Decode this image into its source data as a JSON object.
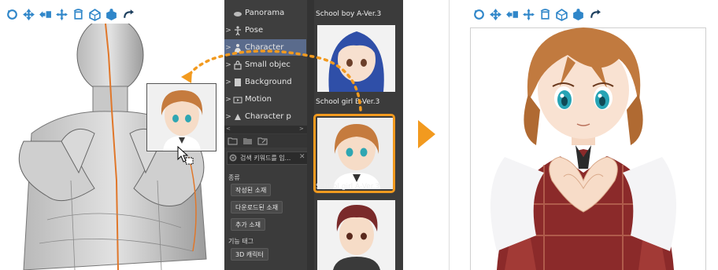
{
  "toolbar": {
    "icons": [
      "rotate-camera-icon",
      "pan-camera-icon",
      "move-camera-icon",
      "move-object-icon",
      "rotate-object-icon",
      "scale-object-icon",
      "rotate-object-alt-icon",
      "reset-icon"
    ]
  },
  "material_tree": {
    "items": [
      {
        "label": "Panorama",
        "icon": "panorama-icon",
        "selected": false
      },
      {
        "label": "Pose",
        "icon": "pose-icon",
        "selected": false
      },
      {
        "label": "Character",
        "icon": "character-icon",
        "selected": true
      },
      {
        "label": "Small objec",
        "icon": "small-object-icon",
        "selected": false
      },
      {
        "label": "Background",
        "icon": "background-icon",
        "selected": false
      },
      {
        "label": "Motion",
        "icon": "motion-icon",
        "selected": false
      },
      {
        "label": "Character p",
        "icon": "character-part-icon",
        "selected": false
      }
    ]
  },
  "search": {
    "placeholder": "검색 키워드를 입..."
  },
  "filters": {
    "type_label": "종류",
    "type_tags": [
      "작성된 소재",
      "다운로드된 소재",
      "추가 소재"
    ],
    "function_label": "기능 태그",
    "function_tags": [
      "3D 캐릭터"
    ]
  },
  "thumbnails": [
    {
      "label": "School boy A-Ver.3"
    },
    {
      "label": "School girl B-Ver.3"
    },
    {
      "label": "School girl A-Ver.3",
      "selected": true
    }
  ],
  "colors": {
    "accent": "#f29a1f",
    "panel_bg": "#3b3b3b",
    "selection": "#5a6b8c",
    "icon_blue": "#2f86c9"
  }
}
